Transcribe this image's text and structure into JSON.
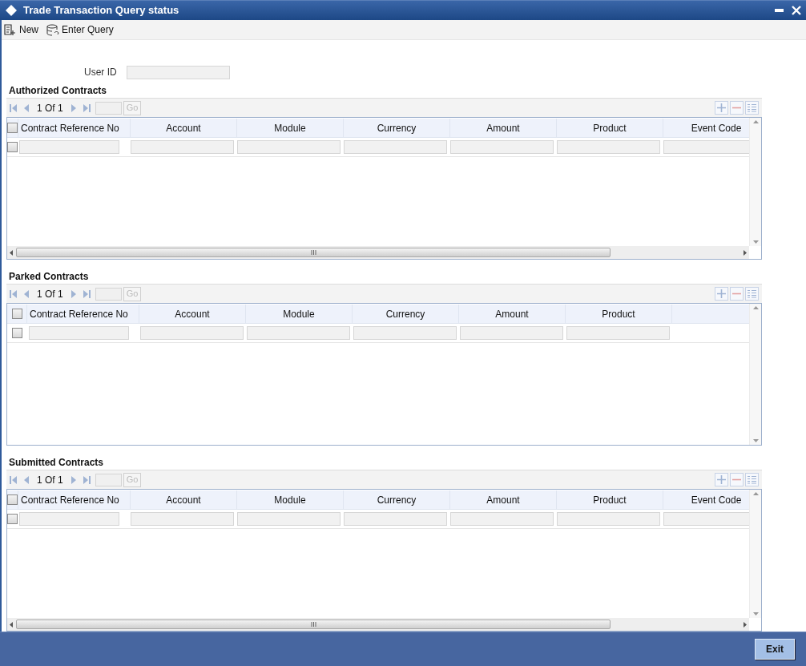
{
  "window": {
    "title": "Trade Transaction Query status"
  },
  "toolbar": [
    {
      "label": "New",
      "kind": "new"
    },
    {
      "label": "Enter Query",
      "kind": "query"
    }
  ],
  "user_id": {
    "label": "User ID"
  },
  "sections": [
    {
      "title": "Authorized Contracts",
      "pager": {
        "text": "1 Of 1",
        "go": "Go"
      },
      "header_checked": false,
      "columns": [
        "Contract Reference No",
        "Account",
        "Module",
        "Currency",
        "Amount",
        "Product",
        "Event Code"
      ],
      "rows": [
        {
          "checked": false
        }
      ]
    },
    {
      "title": "Parked Contracts",
      "pager": {
        "text": "1 Of 1",
        "go": "Go"
      },
      "header_checked": false,
      "columns": [
        "Contract Reference No",
        "Account",
        "Module",
        "Currency",
        "Amount",
        "Product"
      ],
      "rows": [
        {
          "checked": false
        }
      ]
    },
    {
      "title": "Submitted Contracts",
      "pager": {
        "text": "1 Of 1",
        "go": "Go"
      },
      "header_checked": false,
      "columns": [
        "Contract Reference No",
        "Account",
        "Module",
        "Currency",
        "Amount",
        "Product",
        "Event Code"
      ],
      "rows": [
        {
          "checked": false
        }
      ]
    }
  ],
  "footer": {
    "exit": "Exit"
  }
}
